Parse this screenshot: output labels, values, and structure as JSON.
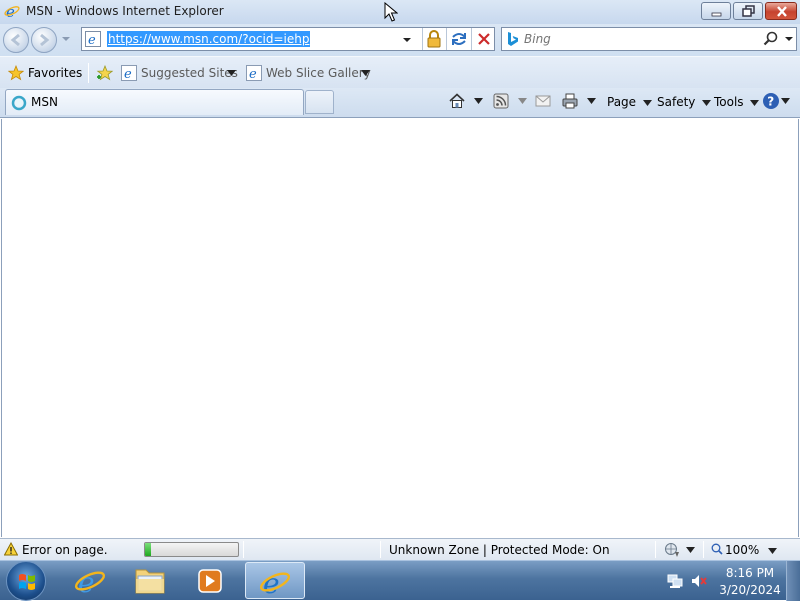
{
  "window": {
    "title": "MSN - Windows Internet Explorer"
  },
  "address_bar": {
    "url": "https://www.msn.com/?ocid=iehp"
  },
  "search": {
    "placeholder": "Bing"
  },
  "favorites_bar": {
    "favorites_label": "Favorites",
    "suggested_sites_label": "Suggested Sites",
    "web_slice_gallery_label": "Web Slice Gallery"
  },
  "tabs": [
    {
      "label": "MSN"
    }
  ],
  "command_bar": {
    "page_label": "Page",
    "safety_label": "Safety",
    "tools_label": "Tools"
  },
  "status_bar": {
    "status_text": "Error on page.",
    "progress_fraction": 0.06,
    "zone_text": "Unknown Zone | Protected Mode: On",
    "zoom_text": "100%"
  },
  "taskbar": {
    "time": "8:16 PM",
    "date": "3/20/2024"
  },
  "colors": {
    "selection": "#3399ff",
    "close_button": "#c6432f",
    "progress": "#1fa81f",
    "taskbar": "#4d74a0"
  }
}
